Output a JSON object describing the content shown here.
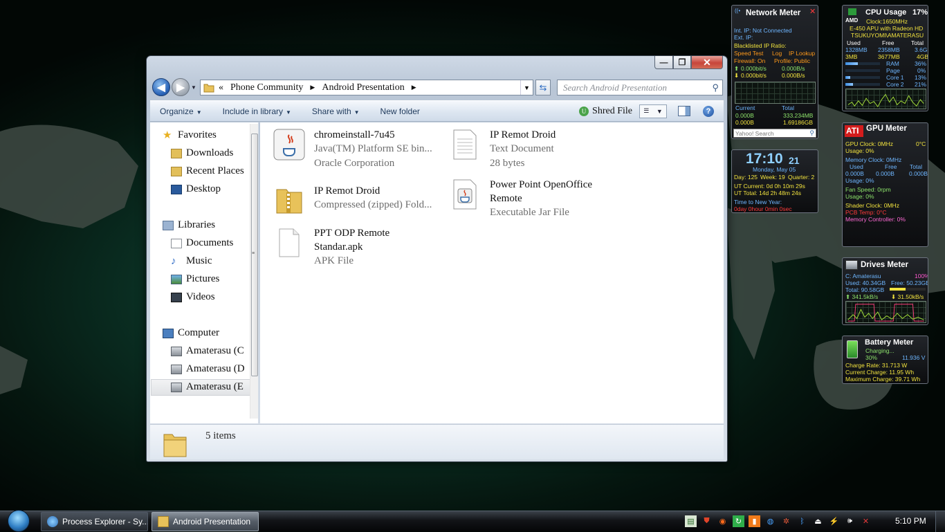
{
  "window": {
    "caption_buttons": {
      "minimize": "—",
      "maximize": "❐",
      "close": "✕"
    },
    "address": {
      "overflow": "«",
      "crumbs": [
        "Phone Community",
        "Android Presentation"
      ]
    },
    "search_placeholder": "Search Android Presentation",
    "toolbar": {
      "organize": "Organize",
      "include_in_library": "Include in library",
      "share_with": "Share with",
      "new_folder": "New folder",
      "shred_file": "Shred File"
    },
    "nav": {
      "favorites": "Favorites",
      "downloads": "Downloads",
      "recent_places": "Recent Places",
      "desktop": "Desktop",
      "libraries": "Libraries",
      "documents": "Documents",
      "music": "Music",
      "pictures": "Pictures",
      "videos": "Videos",
      "computer": "Computer",
      "drive1": "Amaterasu (C",
      "drive2": "Amaterasu (D",
      "drive3": "Amaterasu (E"
    },
    "files": [
      {
        "name": "chromeinstall-7u45",
        "line2": "Java(TM) Platform SE bin...",
        "line3": "Oracle Corporation",
        "icon": "java-icon"
      },
      {
        "name": "IP Remot Droid",
        "line2": "Text Document",
        "line3": "28 bytes",
        "icon": "text-document-icon"
      },
      {
        "name": "IP Remot Droid",
        "line2": "Compressed (zipped) Fold...",
        "line3": "",
        "icon": "zip-folder-icon"
      },
      {
        "name": "Power Point OpenOffice",
        "name2": "Remote",
        "line2": "Executable Jar File",
        "icon": "jar-icon"
      },
      {
        "name": "PPT ODP Remote",
        "name2": "Standar.apk",
        "line2": "APK File",
        "icon": "blank-file-icon"
      }
    ],
    "details": {
      "count": "5 items"
    }
  },
  "gadgets": {
    "network": {
      "title": "Network Meter",
      "int_ip": "Int. IP: Not Connected",
      "ext_ip": "Ext. IP:",
      "blacklisted": "Blacklisted IP Ratio:",
      "speed_test": "Speed Test",
      "log": "Log",
      "ip_lookup": "IP Lookup",
      "firewall": "Firewall: On",
      "profile": "Profile: Public",
      "up_rate": "0.000bit/s",
      "up_rate2": "0.000B/s",
      "down_rate": "0.000bit/s",
      "down_rate2": "0.000B/s",
      "current": "Current",
      "total": "Total",
      "cur_up": "0.000B",
      "cur_down": "0.000B",
      "tot_up": "333.234MB",
      "tot_down": "1.69186GB",
      "search": "Yahoo! Search"
    },
    "clock": {
      "time": "17:10",
      "seconds": "21",
      "date": "Monday, May 05",
      "day": "Day: 125",
      "week": "Week: 19",
      "quarter": "Quarter: 2",
      "ut_current": "UT Current: 0d 0h 10m 29s",
      "ut_total": "UT Total: 14d 2h 48m 24s",
      "new_year_label": "Time to New Year:",
      "new_year": "0day 0hour 0min 0sec"
    },
    "cpu": {
      "title": "CPU Usage",
      "percent": "17%",
      "brand": "AMD",
      "clock": "Clock:1650MHz",
      "model": "E-450 APU with Radeon HD",
      "host": "TSUKUYOMI\\AMATERASU",
      "hdr_used": "Used",
      "hdr_free": "Free",
      "hdr_total": "Total",
      "mem_used": "1328MB",
      "mem_free": "2358MB",
      "mem_total": "3.6GB",
      "page_used": "3MB",
      "page_free": "3677MB",
      "page_total": "4GB",
      "ram_label": "RAM",
      "ram_pct": "36%",
      "ram_level": 36,
      "page_label": "Page",
      "page_pct": "0%",
      "page_level": 0,
      "core1_label": "Core 1",
      "core1_pct": "13%",
      "core1_level": 13,
      "core2_label": "Core 2",
      "core2_pct": "21%",
      "core2_level": 21
    },
    "gpu": {
      "title": "GPU Meter",
      "brand": "ATI",
      "gpu_clock": "GPU Clock: 0MHz",
      "temp": "0°C",
      "usage1": "Usage: 0%",
      "mem_clock": "Memory Clock: 0MHz",
      "hdr_used": "Used",
      "hdr_free": "Free",
      "hdr_total": "Total",
      "used": "0.000B",
      "free": "0.000B",
      "total": "0.000B",
      "usage2": "Usage: 0%",
      "fan": "Fan Speed: 0rpm",
      "usage3": "Usage: 0%",
      "shader": "Shader Clock: 0MHz",
      "pcb": "PCB Temp: 0°C",
      "memctl": "Memory Controller: 0%"
    },
    "drives": {
      "title": "Drives Meter",
      "drive": "C: Amaterasu",
      "drive_pct": "100%",
      "used": "Used: 40.34GB",
      "total": "Total: 90.58GB",
      "free": "Free: 50.23GB",
      "read": "341.5kB/s",
      "write": "31.50kB/s"
    },
    "battery": {
      "title": "Battery Meter",
      "status": "Charging...",
      "pct": "30%",
      "voltage": "11.936 V",
      "rate": "Charge Rate: 31.713 W",
      "current": "Current Charge: 11.95 Wh",
      "max": "Maximum Charge: 39.71 Wh"
    }
  },
  "taskbar": {
    "buttons": [
      "Process Explorer - Sy...",
      "Android Presentation"
    ],
    "clock": "5:10 PM"
  }
}
